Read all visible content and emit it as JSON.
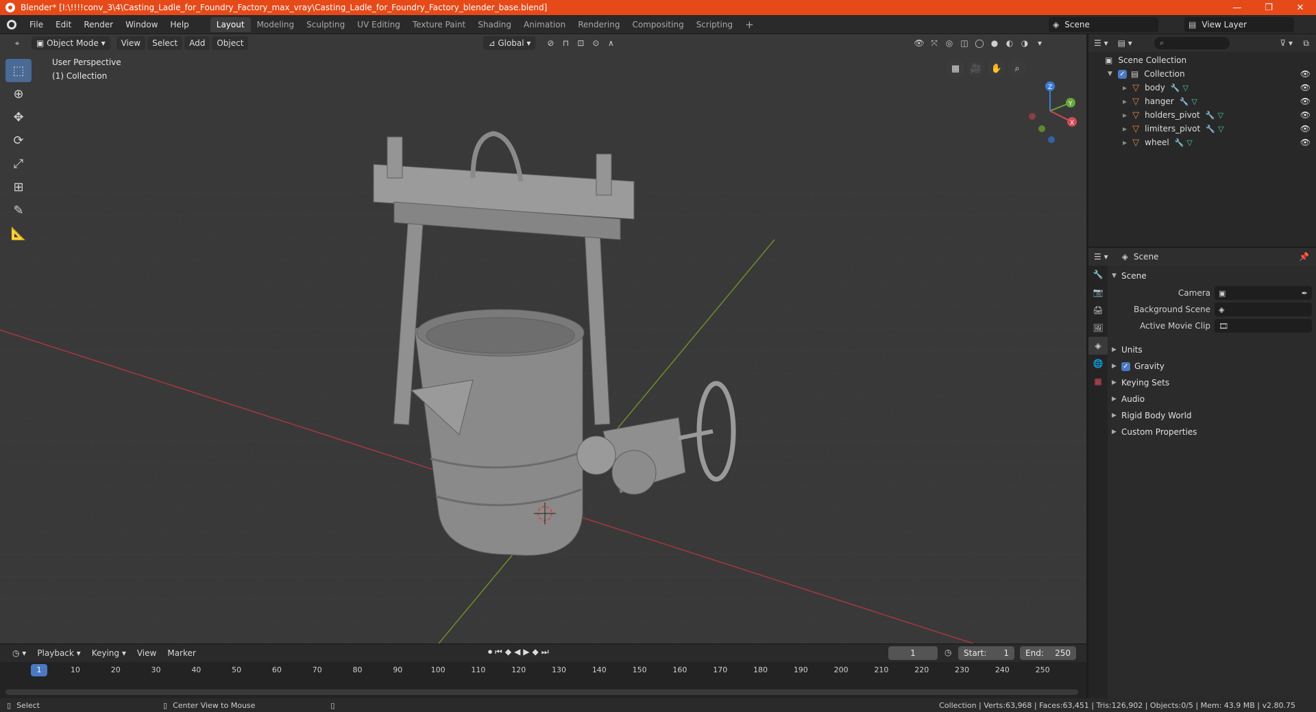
{
  "window": {
    "title": "Blender* [I:\\!!!!conv_3\\4\\Casting_Ladle_for_Foundry_Factory_max_vray\\Casting_Ladle_for_Foundry_Factory_blender_base.blend]",
    "minimize": "—",
    "maximize": "❐",
    "close": "✕"
  },
  "menu": [
    "File",
    "Edit",
    "Render",
    "Window",
    "Help"
  ],
  "workspaces": [
    "Layout",
    "Modeling",
    "Sculpting",
    "UV Editing",
    "Texture Paint",
    "Shading",
    "Animation",
    "Rendering",
    "Compositing",
    "Scripting"
  ],
  "workspace_add": "+",
  "topright": {
    "scene": "Scene",
    "view_layer": "View Layer"
  },
  "viewport": {
    "mode": "Object Mode",
    "menus": [
      "View",
      "Select",
      "Add",
      "Object"
    ],
    "transform_orientation": "Global",
    "perspective_label": "User Perspective",
    "collection_label": "(1) Collection",
    "gizmo": {
      "x": "X",
      "y": "Y",
      "z": "Z"
    }
  },
  "timeline": {
    "menus": [
      "Playback",
      "Keying",
      "View",
      "Marker"
    ],
    "current_frame": "1",
    "start_label": "Start:",
    "start": "1",
    "end_label": "End:",
    "end": "250",
    "ticks": [
      "10",
      "20",
      "30",
      "40",
      "50",
      "60",
      "70",
      "80",
      "90",
      "100",
      "110",
      "120",
      "130",
      "140",
      "150",
      "160",
      "170",
      "180",
      "190",
      "200",
      "210",
      "220",
      "230",
      "240",
      "250"
    ],
    "frame_indicator": "1"
  },
  "statusbar": {
    "left_action": "Select",
    "middle_action": "Center View to Mouse",
    "stats": "Collection | Verts:63,968 | Faces:63,451 | Tris:126,902 | Objects:0/5 | Mem: 43.9 MB | v2.80.75"
  },
  "outliner": {
    "root": "Scene Collection",
    "collection": "Collection",
    "objects": [
      "body",
      "hanger",
      "holders_pivot",
      "limiters_pivot",
      "wheel"
    ]
  },
  "properties": {
    "context": "Scene",
    "section_scene": "Scene",
    "camera_label": "Camera",
    "background_scene_label": "Background Scene",
    "active_movie_clip_label": "Active Movie Clip",
    "sections": [
      "Units",
      "Gravity",
      "Keying Sets",
      "Audio",
      "Rigid Body World",
      "Custom Properties"
    ]
  }
}
